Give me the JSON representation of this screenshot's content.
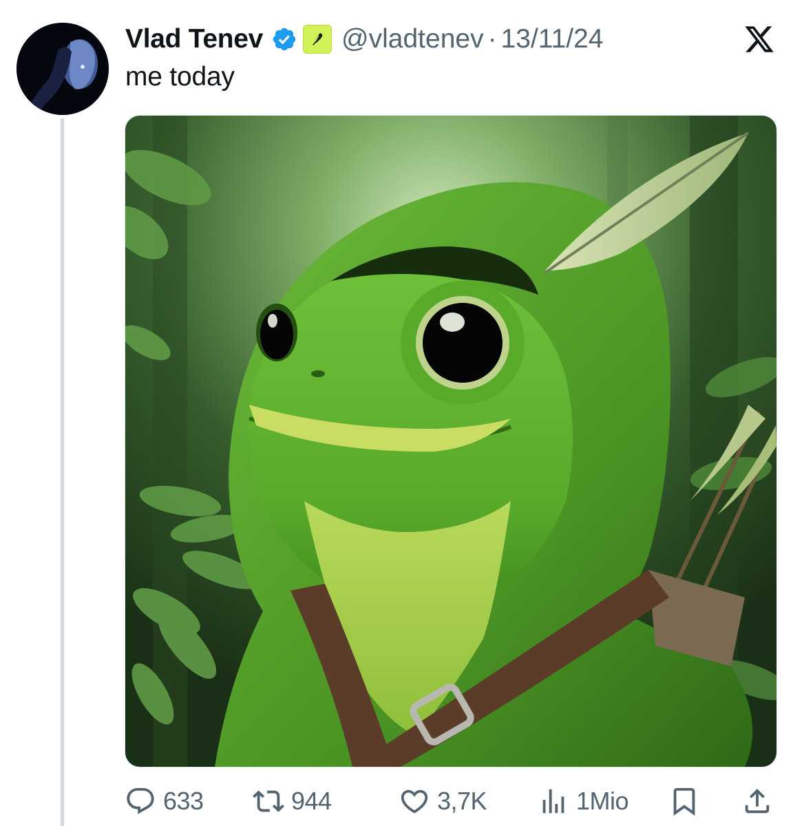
{
  "tweet": {
    "author": {
      "display_name": "Vlad Tenev",
      "handle": "@vladtenev",
      "verified": true
    },
    "separator": "·",
    "timestamp": "13/11/24",
    "text": "me today",
    "platform_logo": "x-logo-icon"
  },
  "actions": {
    "replies": "633",
    "reposts": "944",
    "likes": "3,7K",
    "views": "1Mio"
  },
  "colors": {
    "verified": "#1d9bf0",
    "affiliation_badge": "#d2f25a",
    "secondary_text": "#536471",
    "thread_line": "#cfd9de",
    "frog_green": "#5fae2e",
    "hood_green": "#4f9a28"
  }
}
